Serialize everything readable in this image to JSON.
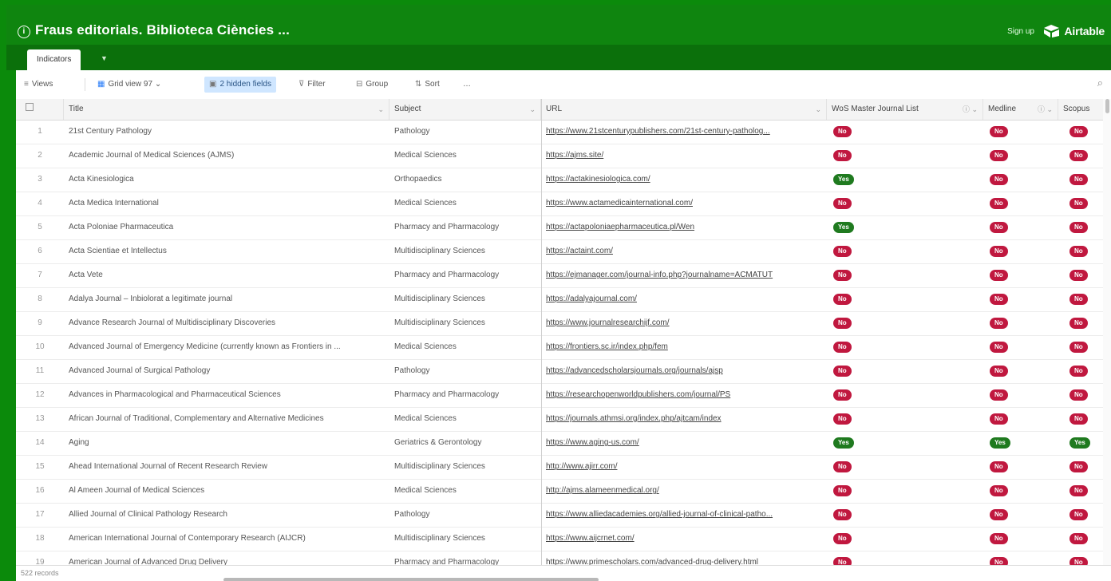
{
  "header": {
    "title": "Fraus editorials. Biblioteca Ciències ...",
    "signup": "Sign up",
    "brand": "Airtable",
    "accent": "#0f850f"
  },
  "tabs": [
    {
      "label": "Indicators"
    }
  ],
  "toolbar": {
    "views": "Views",
    "grid_view": "Grid view",
    "grid_count": "97",
    "hidden_fields": "2 hidden fields",
    "filter": "Filter",
    "group": "Group",
    "sort": "Sort",
    "more": "…"
  },
  "columns": {
    "title": "Title",
    "subject": "Subject",
    "url": "URL",
    "wos": "WoS Master Journal List",
    "medline": "Medline",
    "scopus": "Scopus"
  },
  "rows": [
    {
      "n": "1",
      "title": "21st Century Pathology",
      "subject": "Pathology",
      "url": "https://www.21stcenturypublishers.com/21st-century-patholog...",
      "wos": "No",
      "medline": "No",
      "scopus": "No"
    },
    {
      "n": "2",
      "title": "Academic Journal of Medical Sciences (AJMS)",
      "subject": "Medical Sciences",
      "url": "https://ajms.site/",
      "wos": "No",
      "medline": "No",
      "scopus": "No"
    },
    {
      "n": "3",
      "title": "Acta Kinesiologica",
      "subject": "Orthopaedics",
      "url": "https://actakinesiologica.com/",
      "wos": "Yes",
      "medline": "No",
      "scopus": "No"
    },
    {
      "n": "4",
      "title": "Acta Medica International",
      "subject": "Medical Sciences",
      "url": "https://www.actamedicainternational.com/",
      "wos": "No",
      "medline": "No",
      "scopus": "No"
    },
    {
      "n": "5",
      "title": "Acta Poloniae Pharmaceutica",
      "subject": "Pharmacy and Pharmacology",
      "url": "https://actapoloniaepharmaceutica.pl/Wen",
      "wos": "Yes",
      "medline": "No",
      "scopus": "No"
    },
    {
      "n": "6",
      "title": "Acta Scientiae et Intellectus",
      "subject": "Multidisciplinary Sciences",
      "url": "https://actaint.com/",
      "wos": "No",
      "medline": "No",
      "scopus": "No"
    },
    {
      "n": "7",
      "title": "Acta Vete",
      "subject": "Pharmacy and Pharmacology",
      "url": "https://ejmanager.com/journal-info.php?journalname=ACMATUT",
      "wos": "No",
      "medline": "No",
      "scopus": "No"
    },
    {
      "n": "8",
      "title": "Adalya Journal – Inbiolorat a legitimate journal",
      "subject": "Multidisciplinary Sciences",
      "url": "https://adalyajournal.com/",
      "wos": "No",
      "medline": "No",
      "scopus": "No"
    },
    {
      "n": "9",
      "title": "Advance Research Journal of Multidisciplinary Discoveries",
      "subject": "Multidisciplinary Sciences",
      "url": "https://www.journalresearchijf.com/",
      "wos": "No",
      "medline": "No",
      "scopus": "No"
    },
    {
      "n": "10",
      "title": "Advanced Journal of Emergency Medicine (currently known as Frontiers in ...",
      "subject": "Medical Sciences",
      "url": "https://frontiers.sc.ir/index.php/fem",
      "wos": "No",
      "medline": "No",
      "scopus": "No"
    },
    {
      "n": "11",
      "title": "Advanced Journal of Surgical Pathology",
      "subject": "Pathology",
      "url": "https://advancedscholarsjournals.org/journals/ajsp",
      "wos": "No",
      "medline": "No",
      "scopus": "No"
    },
    {
      "n": "12",
      "title": "Advances in Pharmacological and Pharmaceutical Sciences",
      "subject": "Pharmacy and Pharmacology",
      "url": "https://researchopenworldpublishers.com/journal/PS",
      "wos": "No",
      "medline": "No",
      "scopus": "No"
    },
    {
      "n": "13",
      "title": "African Journal of Traditional, Complementary and Alternative Medicines",
      "subject": "Medical Sciences",
      "url": "https://journals.athmsi.org/index.php/ajtcam/index",
      "wos": "No",
      "medline": "No",
      "scopus": "No"
    },
    {
      "n": "14",
      "title": "Aging",
      "subject": "Geriatrics & Gerontology",
      "url": "https://www.aging-us.com/",
      "wos": "Yes",
      "medline": "Yes",
      "scopus": "Yes"
    },
    {
      "n": "15",
      "title": "Ahead International Journal of Recent Research Review",
      "subject": "Multidisciplinary Sciences",
      "url": "http://www.ajirr.com/",
      "wos": "No",
      "medline": "No",
      "scopus": "No"
    },
    {
      "n": "16",
      "title": "Al Ameen Journal of Medical Sciences",
      "subject": "Medical Sciences",
      "url": "http://ajms.alameenmedical.org/",
      "wos": "No",
      "medline": "No",
      "scopus": "No"
    },
    {
      "n": "17",
      "title": "Allied Journal of Clinical Pathology Research",
      "subject": "Pathology",
      "url": "https://www.alliedacademies.org/allied-journal-of-clinical-patho...",
      "wos": "No",
      "medline": "No",
      "scopus": "No"
    },
    {
      "n": "18",
      "title": "American International Journal of Contemporary Research (AIJCR)",
      "subject": "Multidisciplinary Sciences",
      "url": "https://www.aijcrnet.com/",
      "wos": "No",
      "medline": "No",
      "scopus": "No"
    },
    {
      "n": "19",
      "title": "American Journal of Advanced Drug Delivery",
      "subject": "Pharmacy and Pharmacology",
      "url": "https://www.primescholars.com/advanced-drug-delivery.html",
      "wos": "No",
      "medline": "No",
      "scopus": "No"
    }
  ],
  "footer": {
    "records": "522 records"
  }
}
